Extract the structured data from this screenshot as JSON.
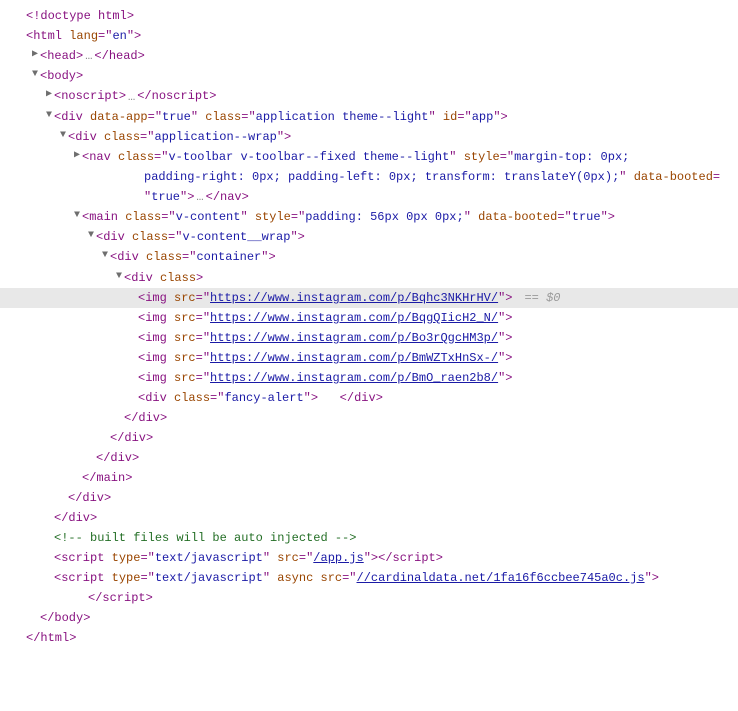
{
  "doctype": "<!doctype html>",
  "tags": {
    "html": "html",
    "head": "head",
    "body": "body",
    "noscript": "noscript",
    "div": "div",
    "nav": "nav",
    "main": "main",
    "img": "img",
    "script": "script"
  },
  "attrs": {
    "lang": "lang",
    "id": "id",
    "class": "class",
    "style": "style",
    "src": "src",
    "type": "type",
    "async": "async",
    "data_app": "data-app",
    "data_booted": "data-booted"
  },
  "vals": {
    "en": "en",
    "app_id": "app",
    "true": "true",
    "app_class": "application theme--light",
    "app_wrap": "application--wrap",
    "nav_class": "v-toolbar v-toolbar--fixed theme--light",
    "nav_style_part1": "margin-top: 0px;",
    "nav_style_part2": "padding-right: 0px; padding-left: 0px; transform: translateY(0px);",
    "main_class": "v-content",
    "main_style": "padding: 56px 0px 0px;",
    "content_wrap": "v-content__wrap",
    "container": "container",
    "fancy_alert": "fancy-alert",
    "text_js": "text/javascript",
    "app_js": "/app.js",
    "cardinal_js": "//cardinaldata.net/1fa16f6ccbee745a0c.js"
  },
  "img_urls": [
    "https://www.instagram.com/p/Bqhc3NKHrHV/",
    "https://www.instagram.com/p/BqgQIicH2_N/",
    "https://www.instagram.com/p/Bo3rQgcHM3p/",
    "https://www.instagram.com/p/BmWZTxHnSx-/",
    "https://www.instagram.com/p/BmO_raen2b8/"
  ],
  "comment": "<!-- built files will be auto injected -->",
  "sel_marker": "== $0",
  "ellipsis": "…",
  "ws": " "
}
